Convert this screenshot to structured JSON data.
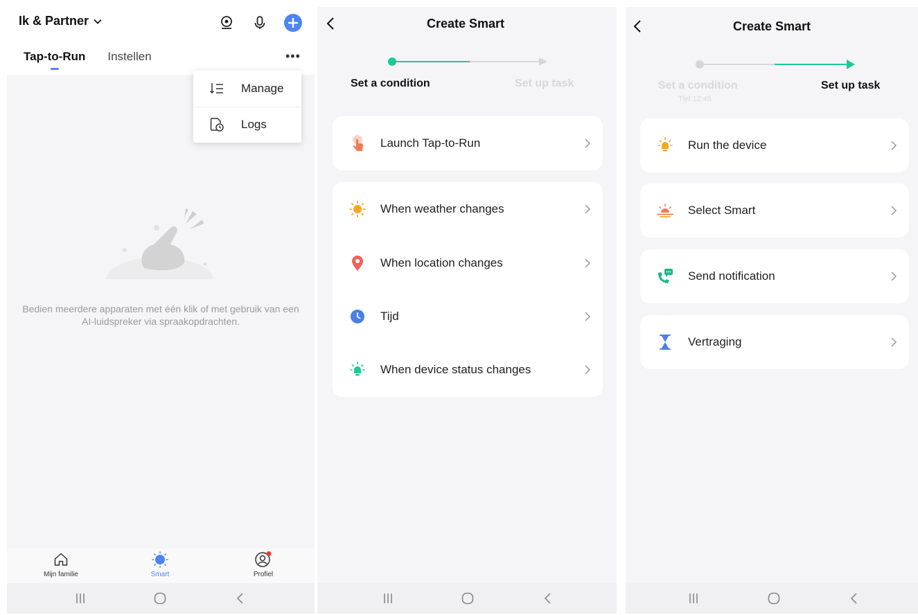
{
  "panel1": {
    "home_name": "Ik & Partner",
    "tabs": [
      "Tap-to-Run",
      "Instellen"
    ],
    "more_label": "•••",
    "menu": [
      "Manage",
      "Logs"
    ],
    "empty_text": "Bedien meerdere apparaten met één klik of met gebruik van een AI-luidspreker via spraakopdrachten.",
    "nav": [
      "Mijn familie",
      "Smart",
      "Profiel"
    ]
  },
  "panel2": {
    "title": "Create Smart",
    "step1": "Set a condition",
    "step2": "Set up task",
    "card1": [
      "Launch Tap-to-Run"
    ],
    "card2": [
      "When weather changes",
      "When location changes",
      "Tijd",
      "When device status changes"
    ]
  },
  "panel3": {
    "title": "Create Smart",
    "step1": "Set a condition",
    "step1_sub": "Tijd:12:45",
    "step2": "Set up task",
    "items": [
      "Run the device",
      "Select Smart",
      "Send notification",
      "Vertraging"
    ]
  },
  "colors": {
    "accent_blue": "#4d84f4",
    "accent_green": "#1fc79a",
    "weather_orange": "#f5a623",
    "location_red": "#f0625a",
    "tap_orange": "#f07a55",
    "notify_green": "#20b885",
    "delay_blue": "#4a7fe8",
    "background": "#f5f5f7"
  },
  "icons": {
    "home_menu": "chevron-down-icon",
    "header": [
      "camera-icon",
      "microphone-icon",
      "plus-icon"
    ],
    "menu": [
      "manage-sort-icon",
      "logs-clock-icon"
    ],
    "nav": [
      "home-icon",
      "smart-sun-icon",
      "profile-icon"
    ],
    "system": [
      "recent-apps-icon",
      "home-circle-icon",
      "back-icon"
    ],
    "conditions": [
      "tap-hand-icon",
      "weather-sun-icon",
      "location-pin-icon",
      "clock-icon",
      "device-bulb-icon"
    ],
    "tasks": [
      "device-bulb-icon",
      "sunrise-scene-icon",
      "notification-phone-icon",
      "hourglass-icon"
    ]
  },
  "progress": {
    "panel2_step": 1,
    "panel3_step": 2,
    "steps_total": 2
  },
  "notification_badge": true
}
